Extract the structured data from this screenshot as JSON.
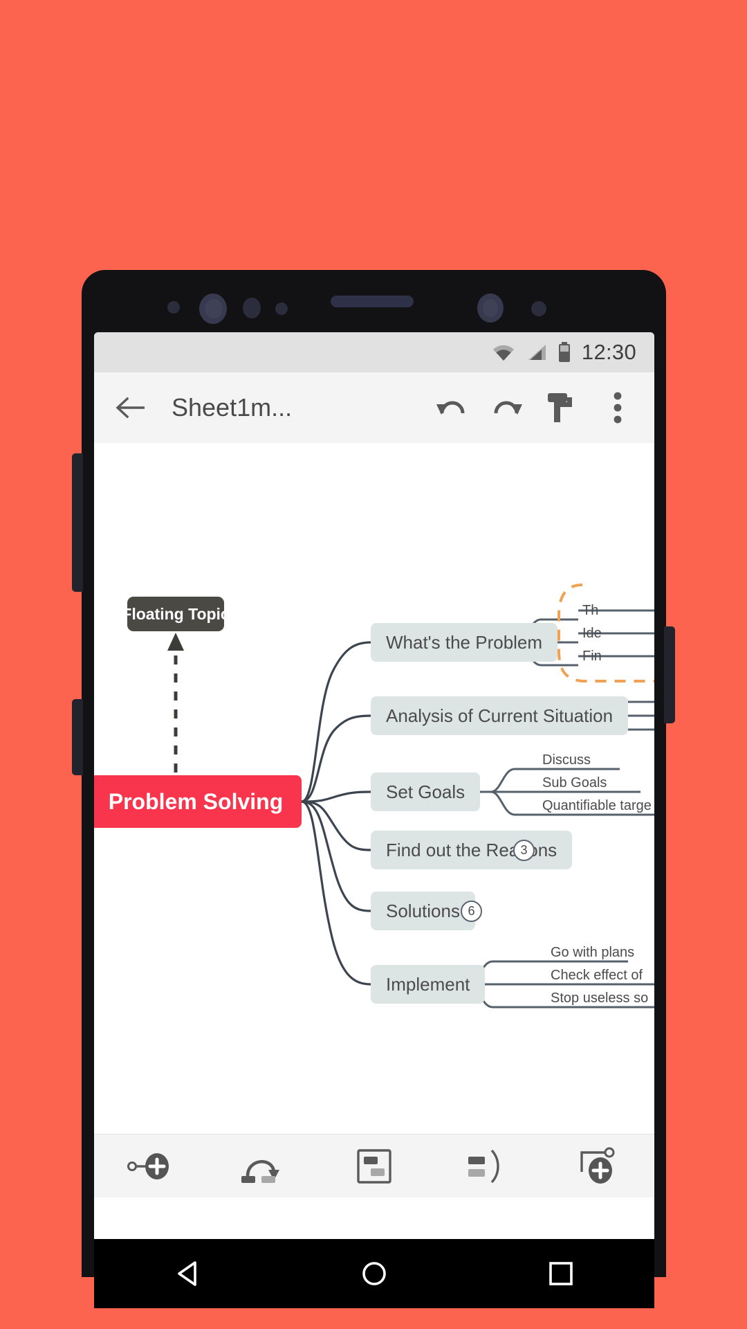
{
  "theme": {
    "background": "#fc6450",
    "accent_red": "#f9344d",
    "branch_fill": "#dce4e4",
    "float_fill": "#4a4944",
    "line_color": "#3c444f",
    "boundary_color": "#f0a254"
  },
  "status_bar": {
    "time": "12:30",
    "icons": [
      "wifi-icon",
      "cellular-signal-icon",
      "battery-icon"
    ]
  },
  "app_bar": {
    "back_icon": "back-arrow-icon",
    "title": "Sheet1m...",
    "actions": [
      {
        "name": "undo-button",
        "icon": "undo-icon"
      },
      {
        "name": "redo-button",
        "icon": "redo-icon"
      },
      {
        "name": "style-button",
        "icon": "paint-roller-icon"
      },
      {
        "name": "overflow-button",
        "icon": "more-vertical-icon"
      }
    ]
  },
  "mindmap": {
    "central": {
      "label": "Problem Solving"
    },
    "floating": {
      "label": "Floating Topic"
    },
    "branches": [
      {
        "label": "What's the Problem",
        "children": [
          "Th",
          "Ide",
          "Fin"
        ],
        "badge": null,
        "boundary": true
      },
      {
        "label": "Analysis of Current Situation",
        "children": [],
        "badge": null
      },
      {
        "label": "Set Goals",
        "children": [
          "Discuss",
          "Sub Goals",
          "Quantifiable targe"
        ],
        "badge": null
      },
      {
        "label": "Find out the Reasons",
        "children": [],
        "badge": "3"
      },
      {
        "label": "Solutions",
        "children": [],
        "badge": "6"
      },
      {
        "label": "Implement",
        "children": [
          "Go with plans",
          "Check effect of",
          "Stop useless so"
        ],
        "badge": null
      }
    ]
  },
  "bottom_toolbar": {
    "items": [
      {
        "name": "add-sibling-topic-button",
        "icon": "node-plus-icon"
      },
      {
        "name": "add-relationship-button",
        "icon": "relationship-arrow-icon"
      },
      {
        "name": "insert-image-button",
        "icon": "card-layout-icon"
      },
      {
        "name": "boundary-button",
        "icon": "boundary-bracket-icon"
      },
      {
        "name": "add-floating-topic-button",
        "icon": "floating-topic-plus-icon"
      }
    ]
  },
  "nav_bar": {
    "items": [
      {
        "name": "nav-back-button",
        "icon": "triangle-back-icon"
      },
      {
        "name": "nav-home-button",
        "icon": "circle-home-icon"
      },
      {
        "name": "nav-recents-button",
        "icon": "square-recents-icon"
      }
    ]
  }
}
